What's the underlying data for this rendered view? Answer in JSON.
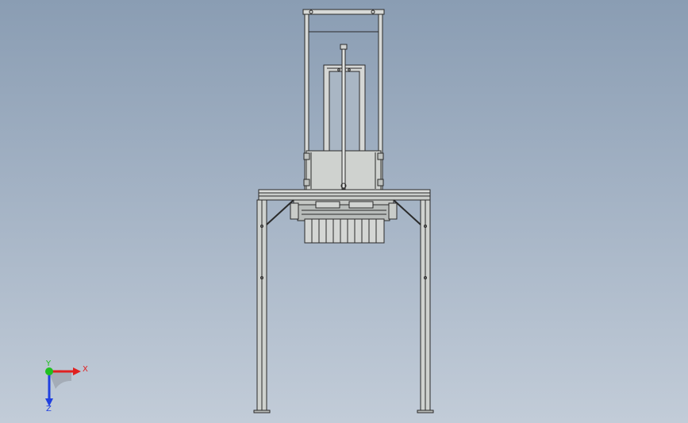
{
  "viewport": {
    "background_top": "#8a9db3",
    "background_bottom": "#c2ccd8",
    "model": "machine-frame-front-view"
  },
  "triad": {
    "x_label": "X",
    "y_label": "Y",
    "z_label": "Z",
    "x_color": "#e02020",
    "y_color": "#20c020",
    "z_color": "#2040e0"
  }
}
